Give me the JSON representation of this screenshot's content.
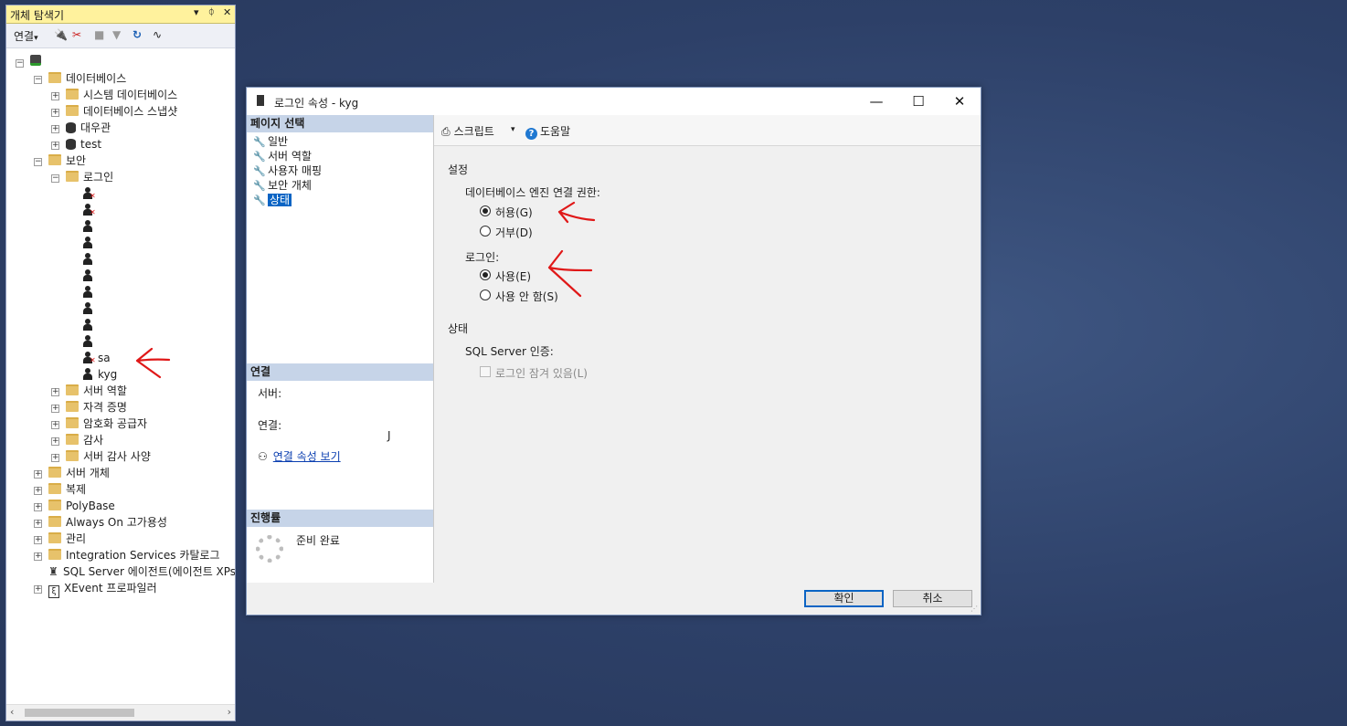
{
  "explorer": {
    "title": "개체 탐색기",
    "title_controls": [
      "▾",
      "ᛰ",
      "✕"
    ],
    "toolbar": {
      "connect": "연결",
      "connect_arrow": "▾"
    },
    "tree": {
      "databases": "데이터베이스",
      "system_databases": "시스템 데이터베이스",
      "db_snapshots": "데이터베이스 스냅샷",
      "db1": "대우관",
      "db2": "test",
      "security": "보안",
      "logins": "로그인",
      "login_sa": "sa",
      "login_kyg": "kyg",
      "server_roles": "서버 역할",
      "credentials": "자격 증명",
      "crypto_providers": "암호화 공급자",
      "audits": "감사",
      "server_audit_specs": "서버 감사 사양",
      "server_objects": "서버 개체",
      "replication": "복제",
      "polybase": "PolyBase",
      "always_on": "Always On 고가용성",
      "management": "관리",
      "integration_services": "Integration Services 카탈로그",
      "sql_agent": "SQL Server 에이전트(에이전트 XPs",
      "xevent": "XEvent 프로파일러"
    }
  },
  "dialog": {
    "title": "로그인 속성 - kyg",
    "window_buttons": {
      "minimize": "—",
      "maximize": "☐",
      "close": "✕"
    },
    "page_select_header": "페이지 선택",
    "pages": [
      "일반",
      "서버 역할",
      "사용자 매핑",
      "보안 개체",
      "상태"
    ],
    "selected_page": "상태",
    "connection_header": "연결",
    "server_label": "서버:",
    "connection_label": "연결:",
    "connection_value": "J",
    "view_connection_props": "연결 속성 보기",
    "progress_header": "진행률",
    "progress_status": "준비 완료",
    "toolbar": {
      "script": "스크립트",
      "script_arrow": "▾",
      "help": "도움말"
    },
    "settings_header": "설정",
    "db_engine_permission_label": "데이터베이스 엔진 연결 권한:",
    "grant_option": "허용(G)",
    "deny_option": "거부(D)",
    "login_label": "로그인:",
    "enabled_option": "사용(E)",
    "disabled_option": "사용 안 함(S)",
    "status_header": "상태",
    "sql_auth_label": "SQL Server 인증:",
    "locked_out_label": "로그인 잠겨 있음(L)",
    "ok_button": "확인",
    "cancel_button": "취소",
    "grant_selected": true,
    "login_enabled": true,
    "locked_out": false
  },
  "colors": {
    "annotation": "#e01818",
    "selection": "#0a64c4",
    "explorer_title": "#fff29d"
  }
}
